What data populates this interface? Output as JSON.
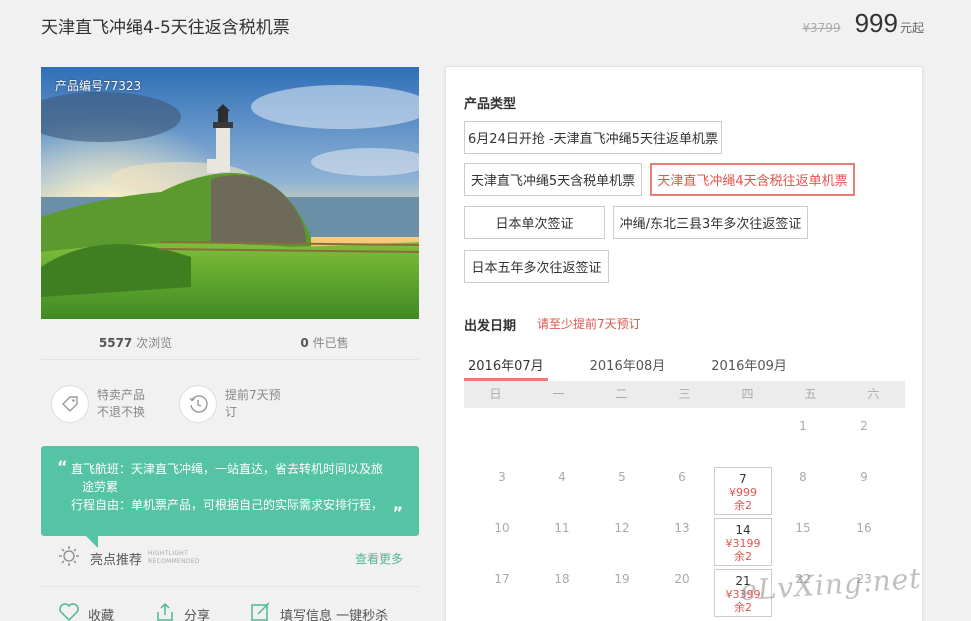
{
  "header": {
    "title": "天津直飞冲绳4-5天往返含税机票",
    "old_price": "¥3799",
    "price": "999",
    "price_unit": "元起"
  },
  "product": {
    "number_label": "产品编号77323",
    "views_count": "5577",
    "views_label": "次浏览",
    "sold_count": "0",
    "sold_label": "件已售"
  },
  "badges": [
    {
      "icon": "tag-icon",
      "line1": "特卖产品",
      "line2": "不退不换"
    },
    {
      "icon": "clock-icon",
      "line1": "提前7天预",
      "line2": "订"
    }
  ],
  "highlight": {
    "line1": "直飞航班：天津直飞冲绳，一站直达，省去转机时间以及旅",
    "line2": "途劳累",
    "line3": "行程自由：单机票产品，可根据自己的实际需求安排行程，",
    "open_quote": "“",
    "close_quote": "”"
  },
  "recommend": {
    "label": "亮点推荐",
    "en_line1": "HIGHTLIGHT",
    "en_line2": "RECOMMENDED",
    "more": "查看更多"
  },
  "actions": [
    {
      "icon": "heart-icon",
      "label": "收藏"
    },
    {
      "icon": "share-icon",
      "label": "分享"
    },
    {
      "icon": "edit-icon",
      "label": "填写信息 一键秒杀"
    }
  ],
  "product_type": {
    "label": "产品类型",
    "options": [
      "6月24日开抢 -天津直飞冲绳5天往返单机票",
      "天津直飞冲绳5天含税单机票",
      "天津直飞冲绳4天含税往返单机票",
      "日本单次签证",
      "冲绳/东北三县3年多次往返签证",
      "日本五年多次往返签证"
    ],
    "selected_index": 2
  },
  "departure": {
    "label": "出发日期",
    "hint": "请至少提前7天预订",
    "months": [
      "2016年07月",
      "2016年08月",
      "2016年09月"
    ],
    "active_month": 0,
    "weekdays": [
      "日",
      "一",
      "二",
      "三",
      "四",
      "五",
      "六"
    ],
    "days": {
      "d1": "1",
      "d2": "2",
      "d3": "3",
      "d4": "4",
      "d5": "5",
      "d6": "6",
      "d7": "7",
      "d8": "8",
      "d9": "9",
      "d10": "10",
      "d11": "11",
      "d12": "12",
      "d13": "13",
      "d14": "14",
      "d15": "15",
      "d16": "16",
      "d17": "17",
      "d18": "18",
      "d19": "19",
      "d20": "20",
      "d21": "21",
      "d22": "22",
      "d23": "23"
    },
    "available": {
      "d7": {
        "price": "¥999",
        "remain": "余2"
      },
      "d14": {
        "price": "¥3199",
        "remain": "余2"
      },
      "d21": {
        "price": "¥3399",
        "remain": "余2"
      }
    }
  },
  "watermark": "eLvXing.net",
  "colors": {
    "accent_red": "#e0564d",
    "green": "#55c4a4"
  }
}
